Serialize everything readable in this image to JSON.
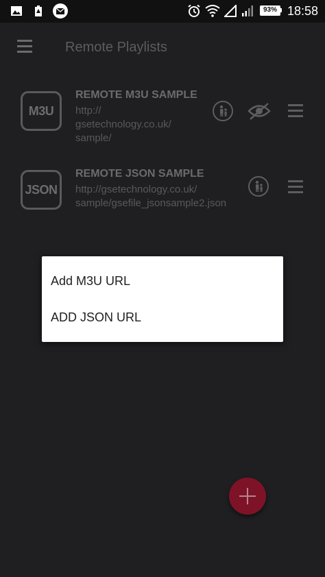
{
  "status_bar": {
    "time": "18:58",
    "battery": "93%",
    "icons": [
      "image-icon",
      "battery-saver-icon",
      "email-icon",
      "alarm-icon",
      "wifi-icon",
      "signal-icon",
      "signal-icon",
      "battery-icon"
    ]
  },
  "toolbar": {
    "title": "Remote Playlists",
    "menu_icon": "hamburger-menu-icon"
  },
  "playlists": [
    {
      "thumb_label": "M3U",
      "title": "REMOTE M3U SAMPLE",
      "url": "http://\ngsetechnology.co.uk/\nsample/",
      "icons": [
        "family-icon",
        "visibility-off-icon",
        "drag-handle-icon"
      ]
    },
    {
      "thumb_label": "JSON",
      "title": "REMOTE JSON SAMPLE",
      "url": "http://gsetechnology.co.uk/\nsample/gsefile_jsonsample2.json",
      "icons": [
        "family-icon",
        "drag-handle-icon"
      ]
    }
  ],
  "popup_menu": {
    "items": [
      {
        "label": "Add M3U URL"
      },
      {
        "label": "ADD JSON URL"
      }
    ]
  },
  "fab": {
    "icon": "plus-icon"
  },
  "colors": {
    "background": "#1f1f21",
    "status_bar": "#111112",
    "fab": "#7e1328",
    "popup": "#ffffff"
  }
}
